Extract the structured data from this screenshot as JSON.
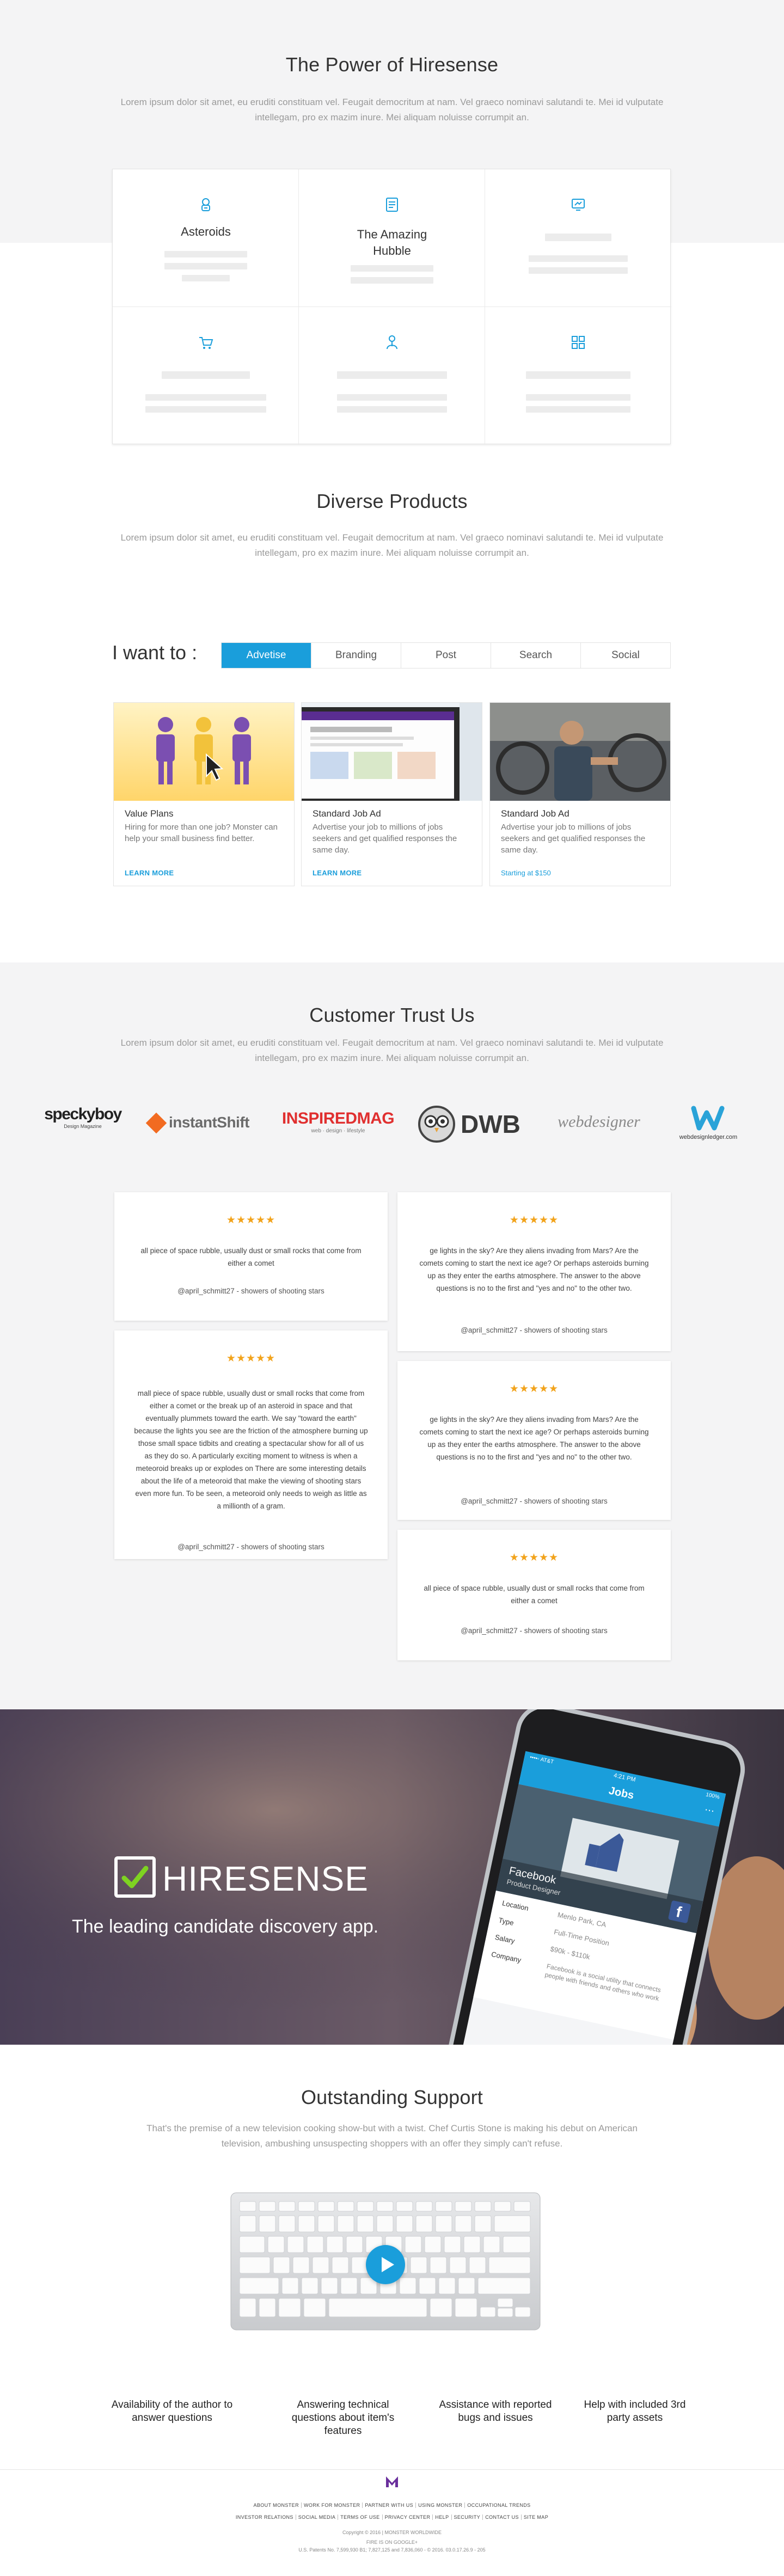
{
  "power": {
    "title": "The Power of Hiresense",
    "lead": "Lorem ipsum dolor sit amet, eu eruditi constituam vel. Feugait democritum at nam. Vel graeco nominavi salutandi te. Mei id vulputate intellegam, pro ex mazim inure. Mei aliquam noluisse corrumpit an.",
    "features": [
      {
        "title": "Asteroids",
        "icon": "astronaut-icon"
      },
      {
        "title": "The Amazing Hubble",
        "icon": "document-icon"
      },
      {
        "title": "",
        "icon": "satellite-icon"
      },
      {
        "title": "",
        "icon": "cart-icon"
      },
      {
        "title": "",
        "icon": "person-icon"
      },
      {
        "title": "",
        "icon": "grid-icon"
      }
    ]
  },
  "diverse": {
    "title": "Diverse Products",
    "lead": "Lorem ipsum dolor sit amet, eu eruditi constituam vel. Feugait democritum at nam. Vel graeco nominavi salutandi te. Mei id vulputate intellegam, pro ex mazim inure. Mei aliquam noluisse corrumpit an.",
    "want_label": "I want to :",
    "tabs": [
      "Advetise",
      "Branding",
      "Post",
      "Search",
      "Social"
    ],
    "active_tab": "Advetise",
    "cards": [
      {
        "title": "Value Plans",
        "desc": "Hiring for more than one job? Monster can help your small business find better.",
        "link": "LEARN MORE"
      },
      {
        "title": "Standard Job Ad",
        "desc": "Advertise your job to millions of jobs seekers and get qualified responses the same day.",
        "link": "LEARN MORE"
      },
      {
        "title": "Standard Job Ad",
        "desc": "Advertise your job to millions of jobs seekers and get qualified responses the same day.",
        "link": "Starting at $150"
      }
    ]
  },
  "trust": {
    "title": "Customer Trust Us",
    "lead": "Lorem ipsum dolor sit amet, eu eruditi constituam vel. Feugait democritum at nam. Vel graeco nominavi salutandi te. Mei id vulputate intellegam, pro ex mazim inure. Mei aliquam noluisse corrumpit an.",
    "logos": {
      "speckyboy": "speckyboy",
      "speckyboy_sub": "Design Magazine",
      "instantshift": "instantShift",
      "inspired": "INSPIREDMAG",
      "inspired_sub": "web · design · lifestyle",
      "dwb": "DWB",
      "webdesigner": "webdesigner",
      "wdl": "webdesignledger.com"
    },
    "stars": "★★★★★",
    "testimonials": [
      {
        "quote": "all piece of space rubble, usually dust or small rocks that come from either a comet",
        "author": "@april_schmitt27 - showers of shooting stars"
      },
      {
        "quote": "mall piece of space rubble, usually dust or small rocks that come from either a comet or the break up of an asteroid in space and that eventually plummets toward the earth. We say \"toward the earth\" because the lights you see are the friction of the atmosphere burning up those small space tidbits and creating a spectacular show for all of us as they do so. A particularly exciting moment to witness is when a meteoroid breaks up or explodes on There are some interesting details about the life of a meteoroid that make the viewing of shooting stars even more fun. To be seen, a meteoroid only needs to weigh as little as a millionth of a gram.",
        "author": "@april_schmitt27 - showers of shooting stars"
      },
      {
        "quote": "ge lights in the sky? Are they aliens invading from Mars? Are the comets coming to start the next ice age? Or perhaps asteroids burning up as they enter the earths atmosphere. The answer to the above questions is no to the first and \"yes and no\" to the other two.",
        "author": "@april_schmitt27 - showers of shooting stars"
      },
      {
        "quote": "ge lights in the sky? Are they aliens invading from Mars? Are the comets coming to start the next ice age? Or perhaps asteroids burning up as they enter the earths atmosphere. The answer to the above questions is no to the first and \"yes and no\" to the other two.",
        "author": "@april_schmitt27 - showers of shooting stars"
      },
      {
        "quote": "all piece of space rubble, usually dust or small rocks that come from either a comet",
        "author": "@april_schmitt27 - showers of shooting stars"
      }
    ]
  },
  "banner": {
    "brand": "HIRESENSE",
    "tagline": "The leading candidate discovery app.",
    "phone": {
      "time": "4:21 PM",
      "carrier": "••••◦ AT&T",
      "battery": "100%",
      "header": "Jobs",
      "company": "Facebook",
      "role": "Product Designer",
      "rows": [
        {
          "label": "Location",
          "value": "Menlo Park, CA"
        },
        {
          "label": "Type",
          "value": "Full-Time Position"
        },
        {
          "label": "Salary",
          "value": "$90k - $110k"
        },
        {
          "label": "Company",
          "value": "Facebook is a social utility that connects people with friends and others who work"
        }
      ]
    }
  },
  "support": {
    "title": "Outstanding Support",
    "lead": "That's the premise of a new television cooking show-but with a twist. Chef Curtis Stone is making his debut on American television, ambushing unsuspecting shoppers with an offer they simply can't refuse.",
    "features": [
      "Availability of the author to answer questions",
      "Answering technical questions about item's features",
      "Assistance with reported bugs and issues",
      "Help with included 3rd party assets"
    ]
  },
  "footer": {
    "links_row1": [
      "ABOUT MONSTER",
      "WORK FOR MONSTER",
      "PARTNER WITH US",
      "USING MONSTER",
      "OCCUPATIONAL TRENDS"
    ],
    "links_row2": [
      "INVESTOR RELATIONS",
      "SOCIAL MEDIA",
      "TERMS OF USE",
      "PRIVACY CENTER",
      "HELP",
      "SECURITY",
      "CONTACT US",
      "SITE MAP"
    ],
    "copyright": "Copyright © 2016 | MONSTER WORLDWIDE",
    "legal1": "FIRE IS ON GOOGLE+",
    "legal2": "U.S. Patents No. 7,599,930 B1; 7,827,125 and 7,836,060 - © 2016. 03.0.17.26.9 - 205"
  },
  "colors": {
    "accent": "#1a9edb",
    "star": "#f2a31b",
    "text": "#333333",
    "muted": "#9a9a9a"
  }
}
